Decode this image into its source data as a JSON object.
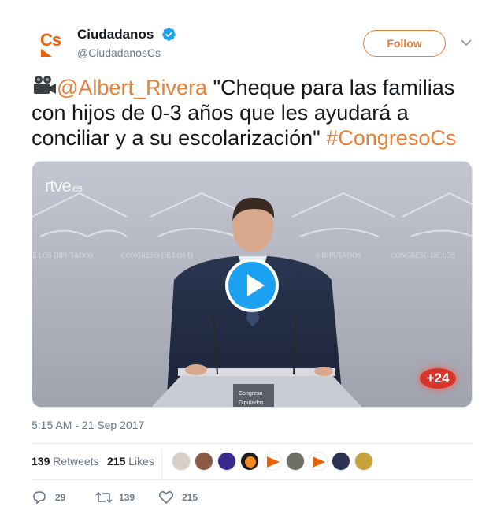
{
  "account": {
    "display_name": "Ciudadanos",
    "handle": "@CiudadanosCs",
    "avatar_text": "Cs",
    "verified_icon": "verified-badge-icon"
  },
  "follow_label": "Follow",
  "tweet": {
    "emoji_icon": "movie-camera-icon",
    "mention": "@Albert_Rivera",
    "body": " \"Cheque para las familias con hijos de 0-3 años que les ayudará a conciliar y a su escolarización\" ",
    "hashtag": "#CongresoCs"
  },
  "media": {
    "watermark": "rtve",
    "watermark_suffix": ".es",
    "channel_badge": "+24",
    "play_icon": "play-icon"
  },
  "timestamp": "5:15 AM - 21 Sep 2017",
  "stats": {
    "retweets_count": "139",
    "retweets_label": "Retweets",
    "likes_count": "215",
    "likes_label": "Likes"
  },
  "actions": {
    "reply_count": "29",
    "retweet_count": "139",
    "like_count": "215"
  },
  "colors": {
    "accent": "#e5803b",
    "brand_orange": "#eb6109",
    "play_blue": "#1da1f2",
    "muted_text": "#657786"
  }
}
